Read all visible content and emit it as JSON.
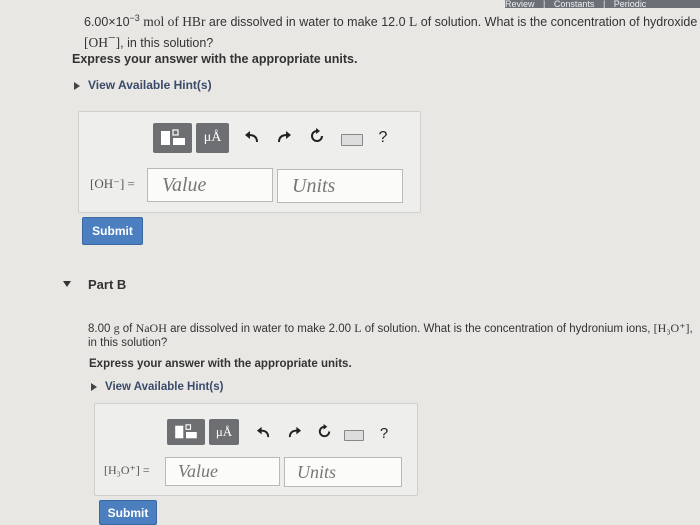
{
  "top_nav": {
    "items": [
      "Review",
      "|",
      "Constants",
      "|",
      "Periodic"
    ]
  },
  "part_a": {
    "question": {
      "amount": "6.00×10",
      "exponent": "−3",
      "middle": " mol of ",
      "acid": "HBr",
      "rest": " are dissolved in water to make 12.0 ",
      "unit_l": "L",
      "rest2": " of solution. What is the concentration of hydroxide ions,",
      "line2_ion": "[OH",
      "line2_sup": "−",
      "line2_close": "]",
      "line2_rest": ", in this solution?"
    },
    "instruction": "Express your answer with the appropriate units.",
    "hint_label": "View Available Hint(s)",
    "answer_label": "[OH⁻] =",
    "value_placeholder": "Value",
    "units_placeholder": "Units",
    "submit_label": "Submit"
  },
  "part_b": {
    "title": "Part B",
    "question": {
      "start": "8.00 ",
      "g": "g",
      "of": " of ",
      "base": "NaOH",
      "rest": " are dissolved in water to make 2.00 ",
      "unit_l": "L",
      "rest2": " of solution. What is the concentration of hydronium ions, ",
      "ion": "[H₃O⁺]",
      "rest3": ",",
      "line2": "in this solution?"
    },
    "instruction": "Express your answer with the appropriate units.",
    "hint_label": "View Available Hint(s)",
    "answer_label": "[H₃O⁺] =",
    "value_placeholder": "Value",
    "units_placeholder": "Units",
    "submit_label": "Submit"
  },
  "toolbar": {
    "templates_icon": "template-icon",
    "units_symbol": "μÅ",
    "help_symbol": "?"
  }
}
